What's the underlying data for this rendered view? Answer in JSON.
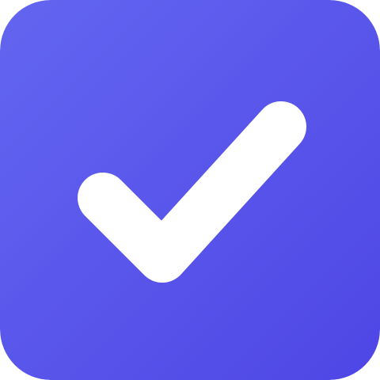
{
  "icon": {
    "name": "checkmark-icon",
    "colors": {
      "gradient_start": "#6366F1",
      "gradient_end": "#4F46E5",
      "check": "#FFFFFF"
    }
  }
}
